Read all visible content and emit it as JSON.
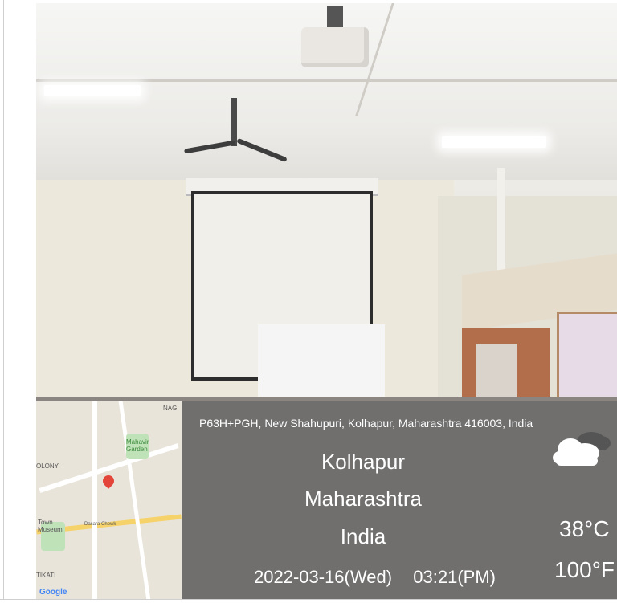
{
  "location": {
    "address": "P63H+PGH, New Shahupuri, Kolhapur, Maharashtra 416003, India",
    "city": "Kolhapur",
    "state": "Maharashtra",
    "country": "India"
  },
  "datetime": {
    "date": "2022-03-16(Wed)",
    "time": "03:21(PM)"
  },
  "weather": {
    "icon": "cloudy-icon",
    "temp_c": "38°C",
    "temp_f": "100°F"
  },
  "map": {
    "labels": [
      "NAG",
      "Mahavir Garden",
      "OLONY",
      "Town Museum",
      "Dasara Chowk",
      "TIKATI",
      "Google"
    ],
    "pin_color": "#e3453b"
  }
}
